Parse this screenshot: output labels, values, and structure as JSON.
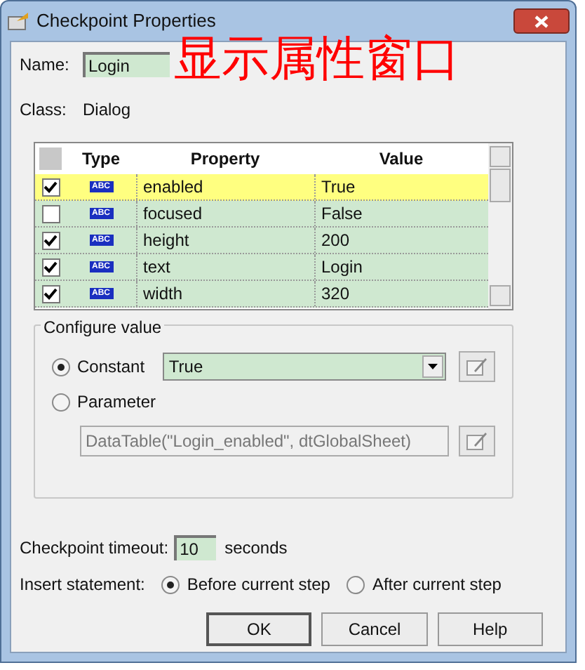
{
  "window": {
    "title": "Checkpoint Properties"
  },
  "annotation": "显示属性窗口",
  "name": {
    "label": "Name:",
    "value": "Login"
  },
  "class": {
    "label": "Class:",
    "value": "Dialog"
  },
  "table": {
    "columns": [
      "Type",
      "Property",
      "Value"
    ],
    "rows": [
      {
        "checked": true,
        "selected": true,
        "type": "ABC",
        "property": "enabled",
        "value": "True"
      },
      {
        "checked": false,
        "selected": false,
        "type": "ABC",
        "property": "focused",
        "value": "False"
      },
      {
        "checked": true,
        "selected": false,
        "type": "ABC",
        "property": "height",
        "value": "200"
      },
      {
        "checked": true,
        "selected": false,
        "type": "ABC",
        "property": "text",
        "value": "Login"
      },
      {
        "checked": true,
        "selected": false,
        "type": "ABC",
        "property": "width",
        "value": "320"
      }
    ]
  },
  "configure": {
    "title": "Configure value",
    "options": [
      {
        "label": "Constant",
        "selected": true
      },
      {
        "label": "Parameter",
        "selected": false
      }
    ],
    "constant_value": "True",
    "parameter_value": "DataTable(\"Login_enabled\", dtGlobalSheet)"
  },
  "timeout": {
    "label": "Checkpoint timeout:",
    "value": "10",
    "unit": "seconds"
  },
  "insert": {
    "label": "Insert statement:",
    "options": [
      {
        "label": "Before current step",
        "selected": true
      },
      {
        "label": "After current step",
        "selected": false
      }
    ]
  },
  "buttons": [
    "OK",
    "Cancel",
    "Help"
  ]
}
